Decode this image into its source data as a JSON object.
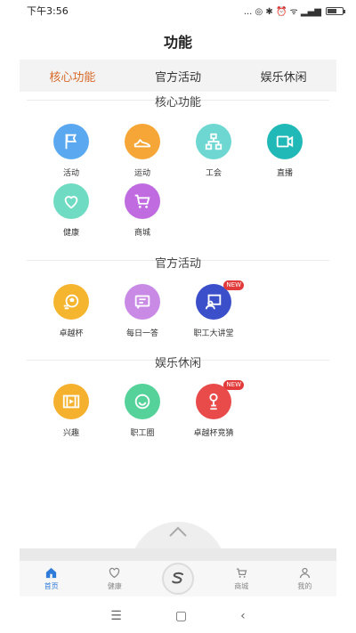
{
  "status_bar": {
    "time": "下午3:56",
    "icons": "... ◎ ✱ ⏰ ᯤ ▂▄▆",
    "battery_level": 0.6
  },
  "page_title": "功能",
  "tabs": [
    {
      "label": "核心功能",
      "active": true
    },
    {
      "label": "官方活动",
      "active": false
    },
    {
      "label": "娱乐休闲",
      "active": false
    }
  ],
  "sections": {
    "core": {
      "title": "核心功能",
      "items": [
        {
          "label": "活动",
          "icon": "flag-icon",
          "color": "#5aa9f0"
        },
        {
          "label": "运动",
          "icon": "sneaker-icon",
          "color": "#f5a636"
        },
        {
          "label": "工会",
          "icon": "org-chart-icon",
          "color": "#6ed7d2"
        },
        {
          "label": "直播",
          "icon": "video-camera-icon",
          "color": "#21b8b8"
        },
        {
          "label": "健康",
          "icon": "heart-icon",
          "color": "#6fdbc3"
        },
        {
          "label": "商城",
          "icon": "cart-icon",
          "color": "#c06be0"
        }
      ]
    },
    "official": {
      "title": "官方活动",
      "items": [
        {
          "label": "卓越杯",
          "icon": "soccer-ball-icon",
          "color": "#f5b52e"
        },
        {
          "label": "每日一答",
          "icon": "quiz-icon",
          "color": "#c98ae6"
        },
        {
          "label": "职工大讲堂",
          "icon": "lecture-icon",
          "color": "#3a4fc9",
          "badge": "NEW"
        }
      ]
    },
    "leisure": {
      "title": "娱乐休闲",
      "items": [
        {
          "label": "兴趣",
          "icon": "film-icon",
          "color": "#f5b12e"
        },
        {
          "label": "职工圈",
          "icon": "smile-icon",
          "color": "#55d29a"
        },
        {
          "label": "卓越杯竞猜",
          "icon": "trophy-icon",
          "color": "#e94a4a",
          "badge": "NEW"
        }
      ]
    }
  },
  "bottom_nav": [
    {
      "label": "首页",
      "icon": "home-icon",
      "active": true
    },
    {
      "label": "健康",
      "icon": "heart-outline-icon",
      "active": false
    },
    {
      "label": "",
      "icon": "center-logo-icon",
      "active": false
    },
    {
      "label": "商城",
      "icon": "cart-outline-icon",
      "active": false
    },
    {
      "label": "我的",
      "icon": "user-icon",
      "active": false
    }
  ],
  "system_nav": {
    "menu": "☰",
    "home": "▢",
    "back": "‹"
  }
}
